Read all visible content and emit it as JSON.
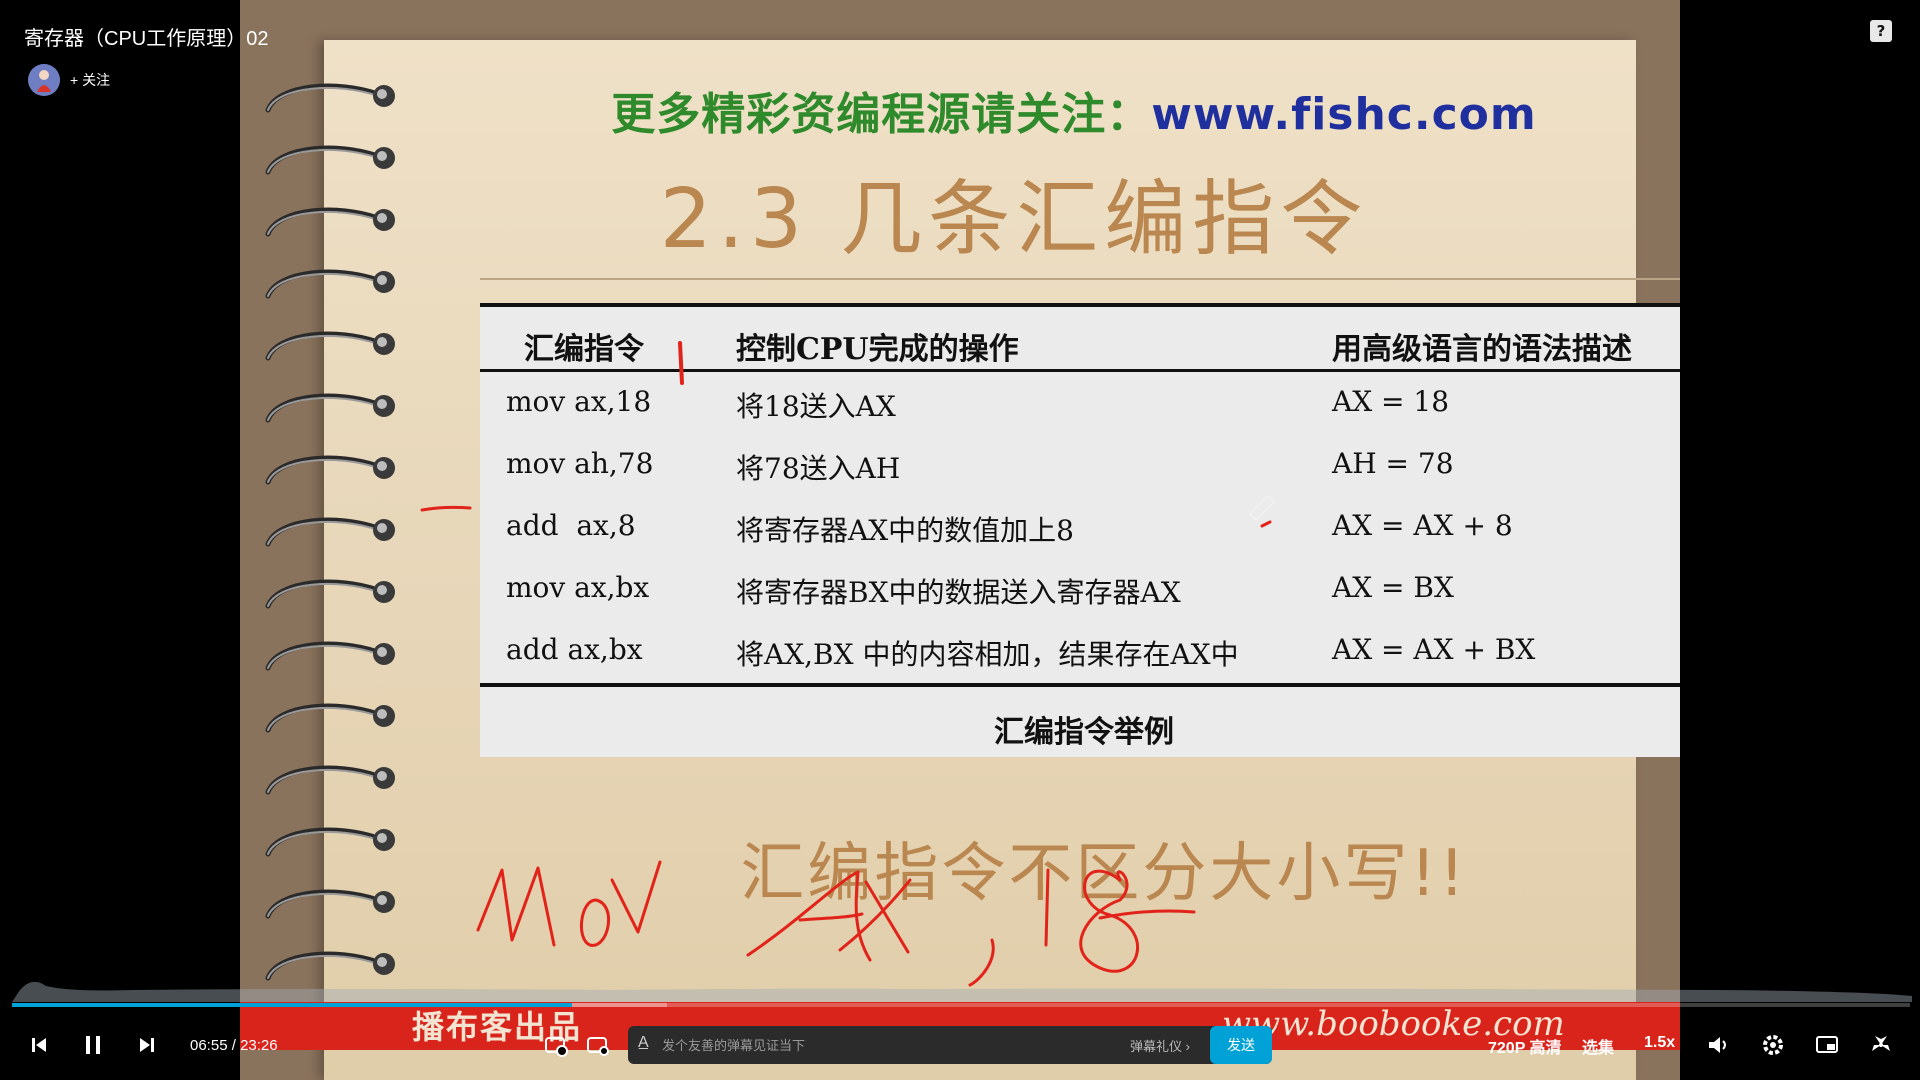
{
  "header": {
    "video_title": "寄存器（CPU工作原理）02",
    "follow_label": "+ 关注",
    "help_icon": "?"
  },
  "slide": {
    "top_banner_left": "更多精彩资编程源请关注：",
    "top_banner_right": "www.fishc.com",
    "title": "2.3 几条汇编指令",
    "table": {
      "headers": [
        "汇编指令",
        "控制CPU完成的操作",
        "用高级语言的语法描述"
      ],
      "rows": [
        [
          "mov ax,18",
          "将18送入AX",
          "AX = 18"
        ],
        [
          "mov ah,78",
          "将78送入AH",
          "AH = 78"
        ],
        [
          "add  ax,8",
          "将寄存器AX中的数值加上8",
          "AX = AX + 8"
        ],
        [
          "mov ax,bx",
          "将寄存器BX中的数据送入寄存器AX",
          "AX = BX"
        ],
        [
          "add ax,bx",
          "将AX,BX 中的内容相加，结果存在AX中",
          "AX = AX + BX"
        ]
      ],
      "caption": "汇编指令举例"
    },
    "case_note": "汇编指令不区分大小写!!",
    "watermark_left": "播布客出品",
    "watermark_right": "www.boobooke.com"
  },
  "player": {
    "current_time": "06:55",
    "separator": "/",
    "duration": "23:26",
    "progress": 0.295,
    "buffered": 0.345,
    "danmaku_placeholder": "发个友善的弹幕见证当下",
    "etiquette_label": "弹幕礼仪 ›",
    "send_label": "发送",
    "quality_label": "720P 高清",
    "episodes_label": "选集",
    "speed_label": "1.5x"
  },
  "colors": {
    "accent": "#00a1d6",
    "watermark_red": "#d9241c",
    "slide_title": "#b9874f"
  },
  "icons": [
    "prev-icon",
    "pause-icon",
    "next-icon",
    "danmaku-toggle-icon",
    "danmaku-settings-icon",
    "volume-icon",
    "settings-icon",
    "pip-icon",
    "fullscreen-icon",
    "help-icon"
  ]
}
